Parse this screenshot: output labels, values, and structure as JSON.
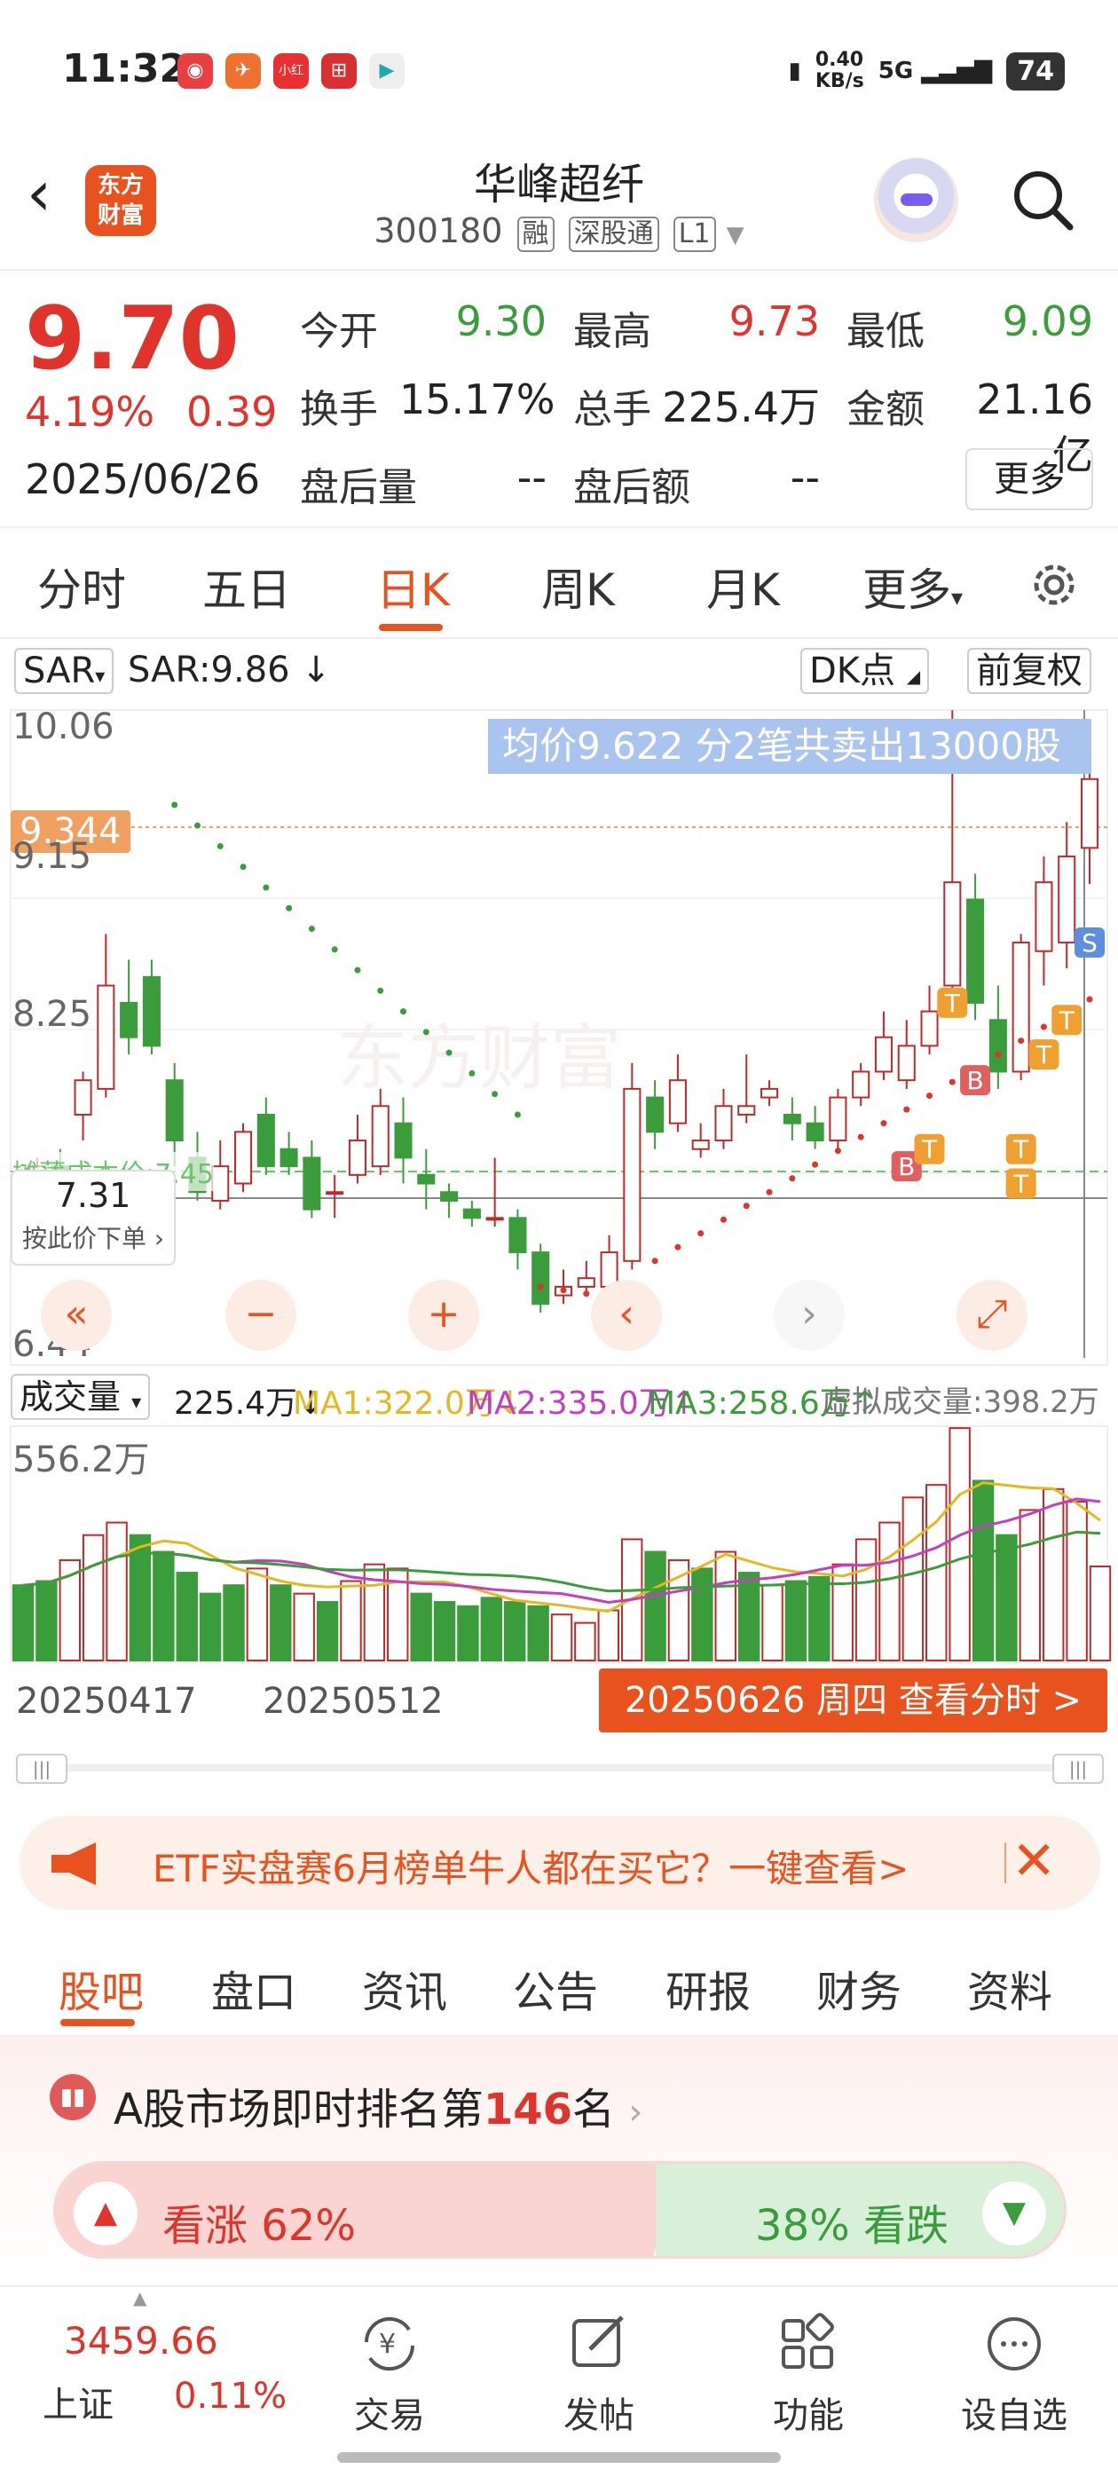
{
  "status_bar": {
    "time": "11:32",
    "net_speed": "0.40",
    "net_unit": "KB/s",
    "signal": "5G",
    "battery": "74"
  },
  "header": {
    "logo_text": "东方\n财富",
    "stock_name": "华峰超纤",
    "stock_code": "300180",
    "tags": [
      "融",
      "深股通",
      "L1"
    ]
  },
  "quote": {
    "price": "9.70",
    "change_pct": "4.19%",
    "change_amt": "0.39",
    "date": "2025/06/26",
    "fields": [
      {
        "label": "今开",
        "value": "9.30",
        "color": "#3a9c3a"
      },
      {
        "label": "最高",
        "value": "9.73",
        "color": "#e0332b"
      },
      {
        "label": "最低",
        "value": "9.09",
        "color": "#3a9c3a"
      },
      {
        "label": "换手",
        "value": "15.17%",
        "color": "#222"
      },
      {
        "label": "总手",
        "value": "225.4万",
        "color": "#222"
      },
      {
        "label": "金额",
        "value": "21.16亿",
        "color": "#222"
      },
      {
        "label": "盘后量",
        "value": "--",
        "color": "#222"
      },
      {
        "label": "盘后额",
        "value": "--",
        "color": "#222"
      }
    ],
    "more_label": "更多"
  },
  "period_tabs": [
    "分时",
    "五日",
    "日K",
    "周K",
    "月K",
    "更多"
  ],
  "period_active": "日K",
  "chart": {
    "indicator": "SAR",
    "indicator_value": "SAR:9.86 ↓",
    "dk_label": "DK点",
    "adjust_label": "前复权",
    "avg_banner": "均价9.622  分2笔共卖出13000股",
    "price_tag": "9.344",
    "y_labels": [
      "10.06",
      "9.15",
      "8.25",
      "6.44"
    ],
    "cost_label": "摊薄成本价:7.45",
    "order_price": "7.31",
    "order_label": "按此价下单",
    "volume_selector": "成交量",
    "volume_value": "225.4万↓",
    "ma1": "MA1:322.0万↓",
    "ma2": "MA2:335.0万↑",
    "ma3": "MA3:258.6万↑",
    "virtual_volume": "虚拟成交量:398.2万",
    "volume_max": "556.2万",
    "date_left": "20250417",
    "date_mid": "20250512",
    "date_button": "20250626 周四 查看分时 >"
  },
  "chart_data": {
    "type": "candlestick",
    "y_range": [
      6.44,
      10.06
    ],
    "candles": [
      [
        7.3,
        7.45,
        7.5,
        7.25
      ],
      [
        7.45,
        7.3,
        7.55,
        7.25
      ],
      [
        7.75,
        7.95,
        8.0,
        7.6
      ],
      [
        7.9,
        8.5,
        8.8,
        7.85
      ],
      [
        8.4,
        8.2,
        8.65,
        8.1
      ],
      [
        8.55,
        8.15,
        8.65,
        8.1
      ],
      [
        7.95,
        7.6,
        8.05,
        7.45
      ],
      [
        7.5,
        7.3,
        7.65,
        7.25
      ],
      [
        7.25,
        7.45,
        7.6,
        7.2
      ],
      [
        7.35,
        7.65,
        7.7,
        7.3
      ],
      [
        7.75,
        7.45,
        7.85,
        7.4
      ],
      [
        7.55,
        7.45,
        7.65,
        7.4
      ],
      [
        7.5,
        7.2,
        7.6,
        7.15
      ],
      [
        7.3,
        7.3,
        7.4,
        7.15
      ],
      [
        7.4,
        7.6,
        7.75,
        7.35
      ],
      [
        7.45,
        7.8,
        7.9,
        7.4
      ],
      [
        7.7,
        7.5,
        7.85,
        7.35
      ],
      [
        7.4,
        7.35,
        7.55,
        7.2
      ],
      [
        7.3,
        7.25,
        7.35,
        7.15
      ],
      [
        7.2,
        7.15,
        7.25,
        7.1
      ],
      [
        7.15,
        7.15,
        7.5,
        7.1
      ],
      [
        7.15,
        6.95,
        7.2,
        6.85
      ],
      [
        6.95,
        6.65,
        7.0,
        6.6
      ],
      [
        6.7,
        6.75,
        6.85,
        6.65
      ],
      [
        6.75,
        6.8,
        6.9,
        6.7
      ],
      [
        6.75,
        6.95,
        7.05,
        6.7
      ],
      [
        6.9,
        7.9,
        8.05,
        6.85
      ],
      [
        7.85,
        7.65,
        7.95,
        7.55
      ],
      [
        7.7,
        7.95,
        8.1,
        7.65
      ],
      [
        7.55,
        7.6,
        7.7,
        7.5
      ],
      [
        7.6,
        7.8,
        7.9,
        7.55
      ],
      [
        7.75,
        7.8,
        8.1,
        7.7
      ],
      [
        7.85,
        7.9,
        7.95,
        7.8
      ],
      [
        7.75,
        7.7,
        7.85,
        7.6
      ],
      [
        7.7,
        7.6,
        7.8,
        7.55
      ],
      [
        7.6,
        7.85,
        7.9,
        7.55
      ],
      [
        7.85,
        8.0,
        8.05,
        7.8
      ],
      [
        8.0,
        8.2,
        8.35,
        7.95
      ],
      [
        7.95,
        8.15,
        8.3,
        7.9
      ],
      [
        8.15,
        8.35,
        8.5,
        8.1
      ],
      [
        8.5,
        9.1,
        10.1,
        8.4
      ],
      [
        9.0,
        8.4,
        9.15,
        8.3
      ],
      [
        8.3,
        8.0,
        8.5,
        7.9
      ],
      [
        8.0,
        8.75,
        8.8,
        7.95
      ],
      [
        8.7,
        9.1,
        9.25,
        8.5
      ],
      [
        8.75,
        9.25,
        9.45,
        8.6
      ],
      [
        9.3,
        9.7,
        9.73,
        9.09
      ]
    ],
    "volume": [
      [
        180,
        false
      ],
      [
        190,
        false
      ],
      [
        240,
        true
      ],
      [
        300,
        true
      ],
      [
        330,
        true
      ],
      [
        300,
        false
      ],
      [
        260,
        false
      ],
      [
        210,
        false
      ],
      [
        160,
        false
      ],
      [
        180,
        false
      ],
      [
        220,
        true
      ],
      [
        180,
        false
      ],
      [
        160,
        true
      ],
      [
        140,
        false
      ],
      [
        190,
        true
      ],
      [
        230,
        true
      ],
      [
        220,
        true
      ],
      [
        160,
        false
      ],
      [
        140,
        false
      ],
      [
        130,
        false
      ],
      [
        150,
        false
      ],
      [
        140,
        false
      ],
      [
        130,
        false
      ],
      [
        110,
        true
      ],
      [
        90,
        true
      ],
      [
        120,
        true
      ],
      [
        290,
        true
      ],
      [
        260,
        false
      ],
      [
        240,
        true
      ],
      [
        220,
        false
      ],
      [
        260,
        true
      ],
      [
        210,
        false
      ],
      [
        180,
        true
      ],
      [
        190,
        false
      ],
      [
        200,
        false
      ],
      [
        230,
        true
      ],
      [
        290,
        true
      ],
      [
        330,
        true
      ],
      [
        390,
        true
      ],
      [
        420,
        true
      ],
      [
        556,
        true
      ],
      [
        430,
        false
      ],
      [
        300,
        false
      ],
      [
        360,
        true
      ],
      [
        410,
        true
      ],
      [
        380,
        true
      ],
      [
        225,
        true
      ]
    ]
  },
  "scroll_handles": {
    "left": "|||",
    "right": "|||"
  },
  "ad_banner": {
    "text": "ETF实盘赛6月榜单牛人都在买它？一键查看>",
    "close": "✕"
  },
  "bottom_tabs": [
    "股吧",
    "盘口",
    "资讯",
    "公告",
    "研报",
    "财务",
    "资料"
  ],
  "bottom_tab_active": "股吧",
  "ranking": {
    "prefix": "A股市场即时排名第",
    "rank": "146",
    "suffix": "名",
    "bullish": "看涨 62%",
    "bearish": "38% 看跌"
  },
  "bottom_nav": {
    "index_value": "3459.66",
    "index_name": "上证",
    "index_change": "0.11%",
    "items": [
      "交易",
      "发帖",
      "功能",
      "设自选"
    ]
  }
}
